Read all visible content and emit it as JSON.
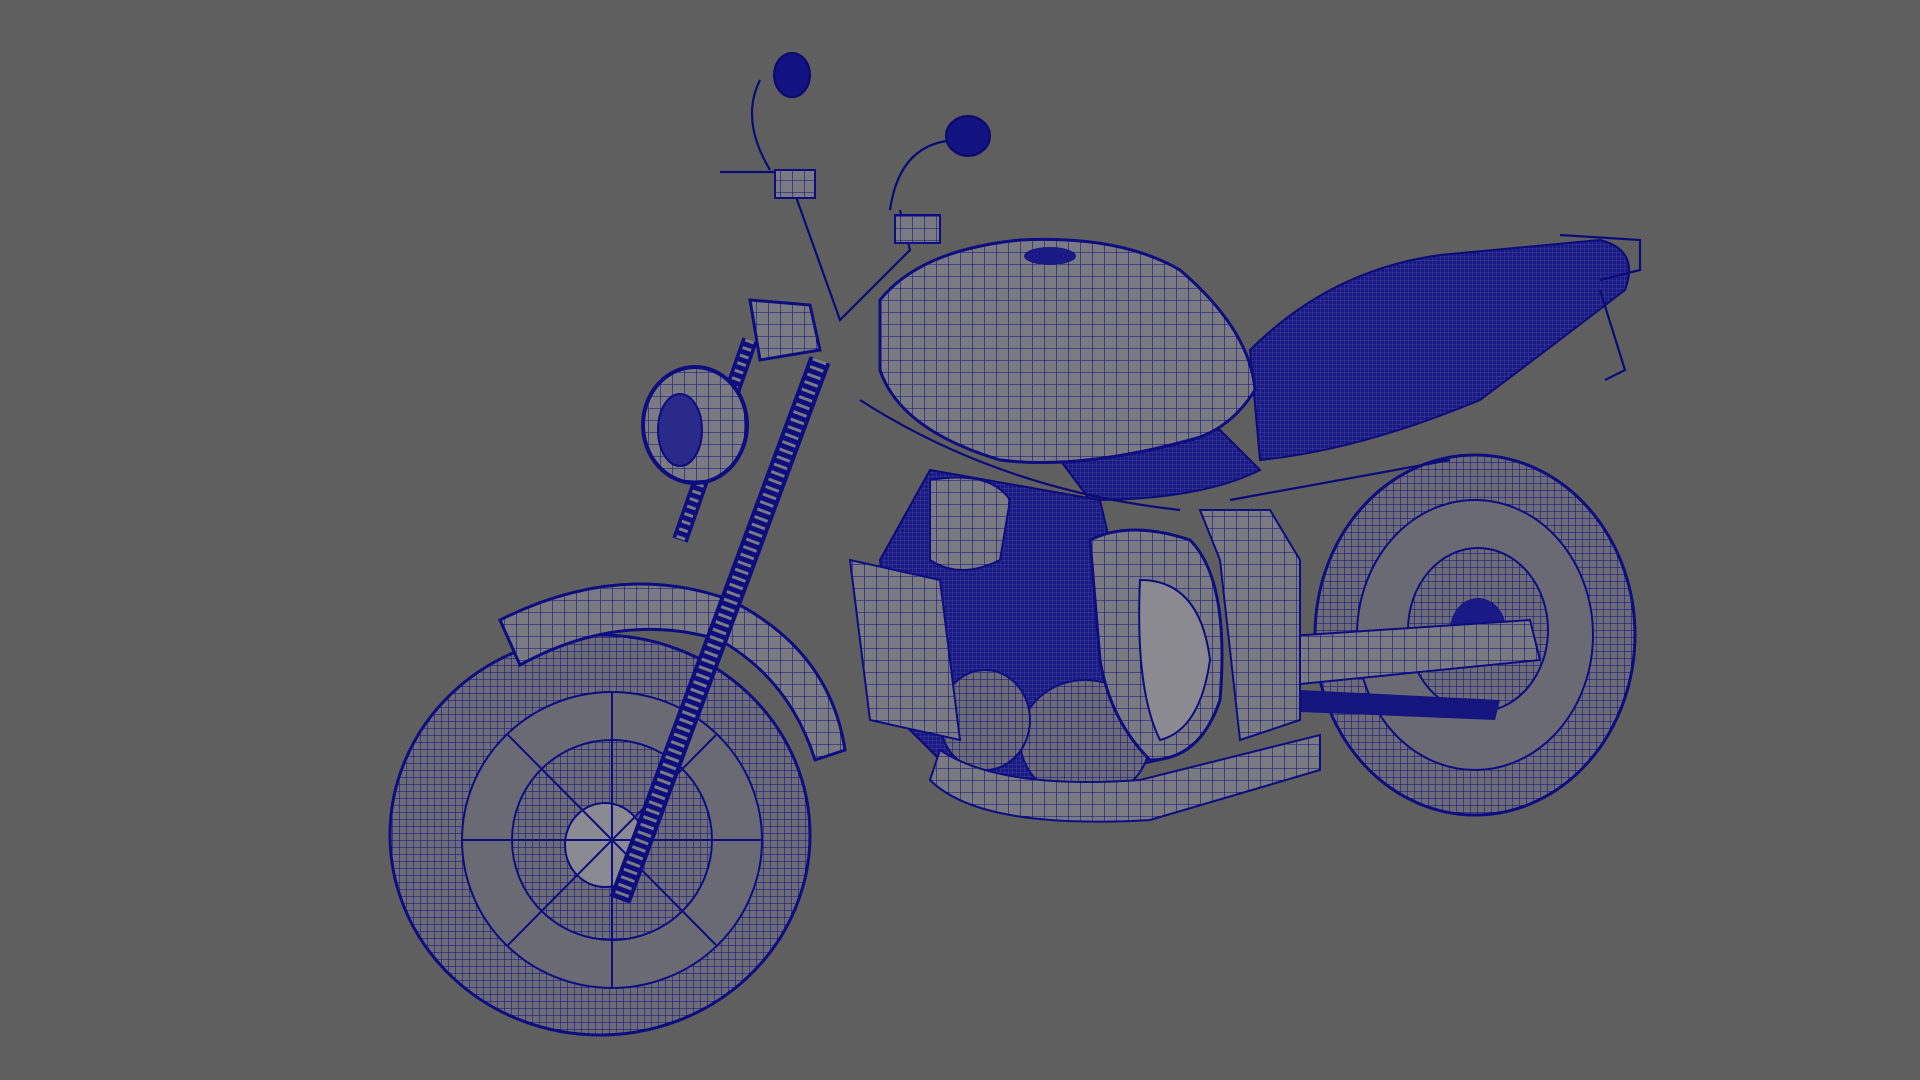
{
  "viewport": {
    "background": "#5f5f5f",
    "wire_color": "#0d0d80",
    "surface_color": "#7a7a82",
    "mode": "wireframe-on-shaded"
  },
  "model": {
    "subject": "motorcycle-icon"
  }
}
